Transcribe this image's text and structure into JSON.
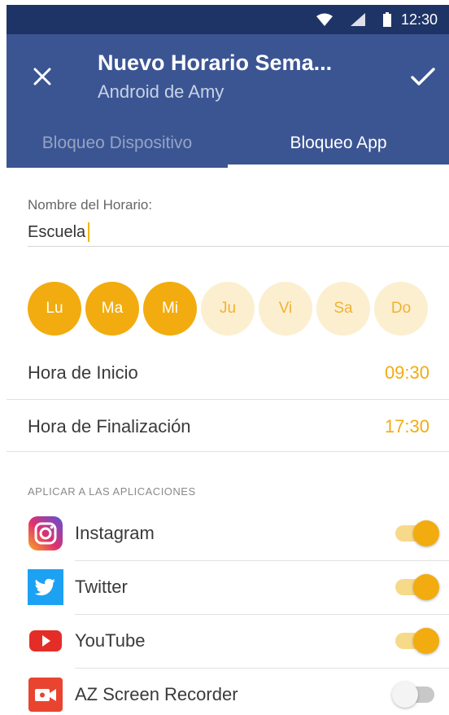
{
  "status_bar": {
    "time": "12:30",
    "icons": [
      "wifi-icon",
      "cell-signal-icon",
      "battery-icon"
    ]
  },
  "header": {
    "title": "Nuevo Horario Sema...",
    "subtitle": "Android de Amy",
    "close_icon": "close-icon",
    "confirm_icon": "check-icon"
  },
  "tabs": [
    {
      "label": "Bloqueo Dispositivo",
      "active": false
    },
    {
      "label": "Bloqueo App",
      "active": true
    }
  ],
  "schedule": {
    "name_label": "Nombre del Horario:",
    "name_value": "Escuela"
  },
  "days": [
    {
      "label": "Lu",
      "selected": true
    },
    {
      "label": "Ma",
      "selected": true
    },
    {
      "label": "Mi",
      "selected": true
    },
    {
      "label": "Ju",
      "selected": false
    },
    {
      "label": "Vi",
      "selected": false
    },
    {
      "label": "Sa",
      "selected": false
    },
    {
      "label": "Do",
      "selected": false
    }
  ],
  "times": {
    "start_label": "Hora de Inicio",
    "start_value": "09:30",
    "end_label": "Hora de Finalización",
    "end_value": "17:30"
  },
  "apps_section": {
    "title": "APLICAR A LAS APLICACIONES",
    "apps": [
      {
        "name": "Instagram",
        "icon": "instagram-icon",
        "enabled": true
      },
      {
        "name": "Twitter",
        "icon": "twitter-icon",
        "enabled": true
      },
      {
        "name": "YouTube",
        "icon": "youtube-icon",
        "enabled": true
      },
      {
        "name": "AZ Screen Recorder",
        "icon": "az-screen-recorder-icon",
        "enabled": false
      }
    ]
  },
  "colors": {
    "header": "#3b5593",
    "status_bar": "#1f3466",
    "accent": "#f2ac0f",
    "accent_light": "#fcefd0"
  }
}
